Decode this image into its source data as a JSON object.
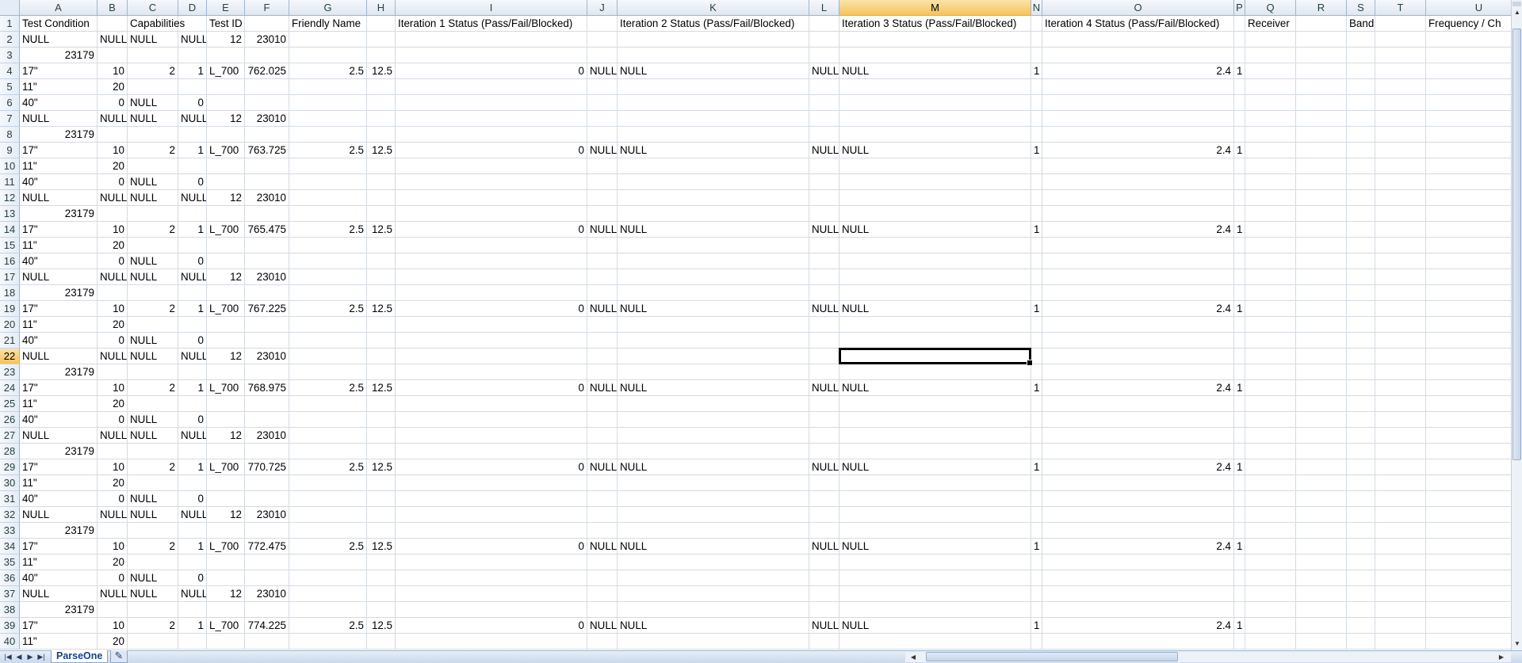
{
  "active_cell": {
    "column": "M",
    "row": "22"
  },
  "columns": [
    {
      "letter": "A"
    },
    {
      "letter": "B"
    },
    {
      "letter": "C"
    },
    {
      "letter": "D"
    },
    {
      "letter": "E"
    },
    {
      "letter": "F"
    },
    {
      "letter": "G"
    },
    {
      "letter": "H"
    },
    {
      "letter": "I"
    },
    {
      "letter": "J"
    },
    {
      "letter": "K"
    },
    {
      "letter": "L"
    },
    {
      "letter": "M"
    },
    {
      "letter": "N"
    },
    {
      "letter": "O"
    },
    {
      "letter": "P"
    },
    {
      "letter": "Q"
    },
    {
      "letter": "R"
    },
    {
      "letter": "S"
    },
    {
      "letter": "T"
    },
    {
      "letter": "U"
    }
  ],
  "header_row": {
    "A": "Test Condition",
    "C": "Capabilities",
    "E": "Test ID",
    "G": "Friendly Name",
    "I": "Iteration 1 Status (Pass/Fail/Blocked)",
    "K": "Iteration 2 Status (Pass/Fail/Blocked)",
    "M": "Iteration 3 Status (Pass/Fail/Blocked)",
    "O": "Iteration 4 Status (Pass/Fail/Blocked)",
    "Q": "Receiver",
    "S": "Band",
    "U": "Frequency / Ch"
  },
  "rows": [
    {
      "n": "2",
      "cells": {
        "A": "NULL",
        "B": "NULL",
        "C": "NULL",
        "D": "NULL",
        "E": "12",
        "F": "23010"
      }
    },
    {
      "n": "3",
      "cells": {
        "A": "23179"
      }
    },
    {
      "n": "4",
      "cells": {
        "A": "17\"",
        "B": "10",
        "C": "2",
        "D": "1",
        "E": "L_700",
        "F": "762.025",
        "G": "2.5",
        "H": "12.5",
        "I": "0",
        "J": "NULL",
        "K": "NULL",
        "L": "NULL",
        "M": "NULL",
        "N": "1",
        "O": "2.4",
        "P": "1"
      }
    },
    {
      "n": "5",
      "cells": {
        "A": "11\"",
        "B": "20"
      }
    },
    {
      "n": "6",
      "cells": {
        "A": "40\"",
        "B": "0",
        "C": "NULL",
        "D": "0"
      }
    },
    {
      "n": "7",
      "cells": {
        "A": "NULL",
        "B": "NULL",
        "C": "NULL",
        "D": "NULL",
        "E": "12",
        "F": "23010"
      }
    },
    {
      "n": "8",
      "cells": {
        "A": "23179"
      }
    },
    {
      "n": "9",
      "cells": {
        "A": "17\"",
        "B": "10",
        "C": "2",
        "D": "1",
        "E": "L_700",
        "F": "763.725",
        "G": "2.5",
        "H": "12.5",
        "I": "0",
        "J": "NULL",
        "K": "NULL",
        "L": "NULL",
        "M": "NULL",
        "N": "1",
        "O": "2.4",
        "P": "1"
      }
    },
    {
      "n": "10",
      "cells": {
        "A": "11\"",
        "B": "20"
      }
    },
    {
      "n": "11",
      "cells": {
        "A": "40\"",
        "B": "0",
        "C": "NULL",
        "D": "0"
      }
    },
    {
      "n": "12",
      "cells": {
        "A": "NULL",
        "B": "NULL",
        "C": "NULL",
        "D": "NULL",
        "E": "12",
        "F": "23010"
      }
    },
    {
      "n": "13",
      "cells": {
        "A": "23179"
      }
    },
    {
      "n": "14",
      "cells": {
        "A": "17\"",
        "B": "10",
        "C": "2",
        "D": "1",
        "E": "L_700",
        "F": "765.475",
        "G": "2.5",
        "H": "12.5",
        "I": "0",
        "J": "NULL",
        "K": "NULL",
        "L": "NULL",
        "M": "NULL",
        "N": "1",
        "O": "2.4",
        "P": "1"
      }
    },
    {
      "n": "15",
      "cells": {
        "A": "11\"",
        "B": "20"
      }
    },
    {
      "n": "16",
      "cells": {
        "A": "40\"",
        "B": "0",
        "C": "NULL",
        "D": "0"
      }
    },
    {
      "n": "17",
      "cells": {
        "A": "NULL",
        "B": "NULL",
        "C": "NULL",
        "D": "NULL",
        "E": "12",
        "F": "23010"
      }
    },
    {
      "n": "18",
      "cells": {
        "A": "23179"
      }
    },
    {
      "n": "19",
      "cells": {
        "A": "17\"",
        "B": "10",
        "C": "2",
        "D": "1",
        "E": "L_700",
        "F": "767.225",
        "G": "2.5",
        "H": "12.5",
        "I": "0",
        "J": "NULL",
        "K": "NULL",
        "L": "NULL",
        "M": "NULL",
        "N": "1",
        "O": "2.4",
        "P": "1"
      }
    },
    {
      "n": "20",
      "cells": {
        "A": "11\"",
        "B": "20"
      }
    },
    {
      "n": "21",
      "cells": {
        "A": "40\"",
        "B": "0",
        "C": "NULL",
        "D": "0"
      }
    },
    {
      "n": "22",
      "cells": {
        "A": "NULL",
        "B": "NULL",
        "C": "NULL",
        "D": "NULL",
        "E": "12",
        "F": "23010"
      }
    },
    {
      "n": "23",
      "cells": {
        "A": "23179"
      }
    },
    {
      "n": "24",
      "cells": {
        "A": "17\"",
        "B": "10",
        "C": "2",
        "D": "1",
        "E": "L_700",
        "F": "768.975",
        "G": "2.5",
        "H": "12.5",
        "I": "0",
        "J": "NULL",
        "K": "NULL",
        "L": "NULL",
        "M": "NULL",
        "N": "1",
        "O": "2.4",
        "P": "1"
      }
    },
    {
      "n": "25",
      "cells": {
        "A": "11\"",
        "B": "20"
      }
    },
    {
      "n": "26",
      "cells": {
        "A": "40\"",
        "B": "0",
        "C": "NULL",
        "D": "0"
      }
    },
    {
      "n": "27",
      "cells": {
        "A": "NULL",
        "B": "NULL",
        "C": "NULL",
        "D": "NULL",
        "E": "12",
        "F": "23010"
      }
    },
    {
      "n": "28",
      "cells": {
        "A": "23179"
      }
    },
    {
      "n": "29",
      "cells": {
        "A": "17\"",
        "B": "10",
        "C": "2",
        "D": "1",
        "E": "L_700",
        "F": "770.725",
        "G": "2.5",
        "H": "12.5",
        "I": "0",
        "J": "NULL",
        "K": "NULL",
        "L": "NULL",
        "M": "NULL",
        "N": "1",
        "O": "2.4",
        "P": "1"
      }
    },
    {
      "n": "30",
      "cells": {
        "A": "11\"",
        "B": "20"
      }
    },
    {
      "n": "31",
      "cells": {
        "A": "40\"",
        "B": "0",
        "C": "NULL",
        "D": "0"
      }
    },
    {
      "n": "32",
      "cells": {
        "A": "NULL",
        "B": "NULL",
        "C": "NULL",
        "D": "NULL",
        "E": "12",
        "F": "23010"
      }
    },
    {
      "n": "33",
      "cells": {
        "A": "23179"
      }
    },
    {
      "n": "34",
      "cells": {
        "A": "17\"",
        "B": "10",
        "C": "2",
        "D": "1",
        "E": "L_700",
        "F": "772.475",
        "G": "2.5",
        "H": "12.5",
        "I": "0",
        "J": "NULL",
        "K": "NULL",
        "L": "NULL",
        "M": "NULL",
        "N": "1",
        "O": "2.4",
        "P": "1"
      }
    },
    {
      "n": "35",
      "cells": {
        "A": "11\"",
        "B": "20"
      }
    },
    {
      "n": "36",
      "cells": {
        "A": "40\"",
        "B": "0",
        "C": "NULL",
        "D": "0"
      }
    },
    {
      "n": "37",
      "cells": {
        "A": "NULL",
        "B": "NULL",
        "C": "NULL",
        "D": "NULL",
        "E": "12",
        "F": "23010"
      }
    },
    {
      "n": "38",
      "cells": {
        "A": "23179"
      }
    },
    {
      "n": "39",
      "cells": {
        "A": "17\"",
        "B": "10",
        "C": "2",
        "D": "1",
        "E": "L_700",
        "F": "774.225",
        "G": "2.5",
        "H": "12.5",
        "I": "0",
        "J": "NULL",
        "K": "NULL",
        "L": "NULL",
        "M": "NULL",
        "N": "1",
        "O": "2.4",
        "P": "1"
      }
    },
    {
      "n": "40",
      "cells": {
        "A": "11\"",
        "B": "20"
      }
    }
  ],
  "sheet_tabs": [
    {
      "label": "ParseOne"
    }
  ],
  "new_sheet_icon": "insert-worksheet-icon",
  "nav_icons": [
    "first-sheet-icon",
    "prev-sheet-icon",
    "next-sheet-icon",
    "last-sheet-icon"
  ]
}
